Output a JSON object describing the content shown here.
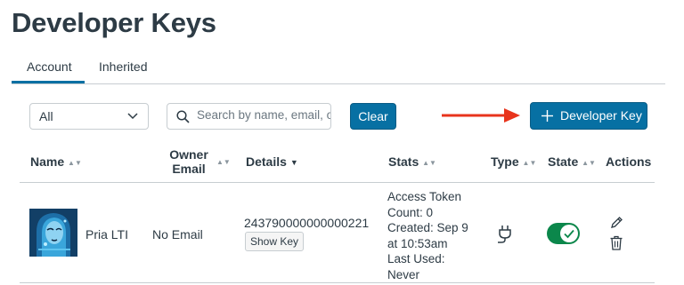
{
  "page": {
    "title": "Developer Keys"
  },
  "tabs": [
    {
      "label": "Account",
      "active": true
    },
    {
      "label": "Inherited",
      "active": false
    }
  ],
  "filters": {
    "type_select": {
      "value": "All"
    },
    "search": {
      "placeholder": "Search by name, email, or ID",
      "visible_text": "Search by name, email,"
    },
    "clear_label": "Clear",
    "add_label": "Developer Key"
  },
  "table": {
    "columns": [
      {
        "label": "Name",
        "sortable": true
      },
      {
        "label_line1": "Owner",
        "label_line2": "Email",
        "sortable": true
      },
      {
        "label": "Details",
        "sorted": "desc"
      },
      {
        "label": "Stats",
        "sortable": true
      },
      {
        "label": "Type",
        "sortable": true
      },
      {
        "label": "State",
        "sortable": true
      },
      {
        "label": "Actions"
      }
    ],
    "rows": [
      {
        "name": "Pria LTI",
        "owner_email": "No Email",
        "key_id": "243790000000000221",
        "show_key_label": "Show Key",
        "stats": [
          "Access Token",
          "Count: 0",
          "Created: Sep 9",
          "at 10:53am",
          "Last Used:",
          "Never"
        ],
        "type_icon": "plug-icon",
        "state_on": true
      }
    ]
  },
  "colors": {
    "primary": "#0770a3",
    "toggle_on": "#0b874b",
    "arrow": "#e8341c",
    "text": "#2d3b45"
  }
}
